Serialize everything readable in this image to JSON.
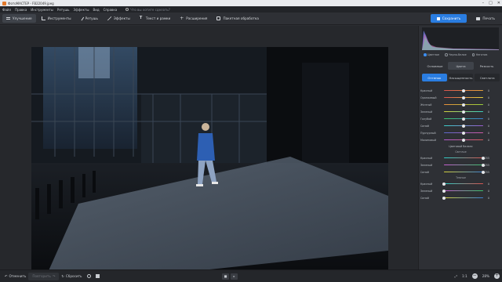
{
  "window": {
    "title": "ФотоМАСТЕР - FB22049.jpeg"
  },
  "menu": {
    "items": [
      "Файл",
      "Правка",
      "Инструменты",
      "Ретушь",
      "Эффекты",
      "Вид",
      "Справка"
    ],
    "search_placeholder": "Что вы хотите сделать?"
  },
  "toolbar": {
    "tools": [
      {
        "label": "Улучшение",
        "icon": "sliders-icon"
      },
      {
        "label": "Инструменты",
        "icon": "crop-icon"
      },
      {
        "label": "Ретушь",
        "icon": "brush-icon"
      },
      {
        "label": "Эффекты",
        "icon": "magic-wand-icon"
      },
      {
        "label": "Текст и рамки",
        "icon": "text-icon"
      },
      {
        "label": "Расширения",
        "icon": "plus-icon"
      },
      {
        "label": "Пакетная обработка",
        "icon": "batch-icon"
      }
    ],
    "save_label": "Сохранить",
    "print_label": "Печать"
  },
  "panel": {
    "radios": [
      {
        "label": "Цветное",
        "checked": true
      },
      {
        "label": "Черно-белое",
        "checked": false
      },
      {
        "label": "Негатив",
        "checked": false
      }
    ],
    "main_tabs": [
      "Основные",
      "Цвета",
      "Резкость"
    ],
    "main_tab_active": "Цвета",
    "sub_tabs": [
      "Оттенок",
      "Насыщенность",
      "Светлота"
    ],
    "sub_tab_active": "Оттенок",
    "hue": [
      {
        "label": "Красный",
        "value": "0",
        "colors": [
          "#d9534f",
          "#e8a33a"
        ]
      },
      {
        "label": "Оранжевый",
        "value": "0",
        "colors": [
          "#d9534f",
          "#e8d23a"
        ]
      },
      {
        "label": "Желтый",
        "value": "0",
        "colors": [
          "#e88f3a",
          "#9ad13a"
        ]
      },
      {
        "label": "Зеленый",
        "value": "0",
        "colors": [
          "#d6d13a",
          "#3ad1c1"
        ]
      },
      {
        "label": "Голубой",
        "value": "0",
        "colors": [
          "#3ac46a",
          "#3a7fd1"
        ]
      },
      {
        "label": "Синий",
        "value": "0",
        "colors": [
          "#3ad1c9",
          "#9b5ad1"
        ]
      },
      {
        "label": "Пурпурный",
        "value": "0",
        "colors": [
          "#5a6ad1",
          "#d15aa7"
        ]
      },
      {
        "label": "Малиновый",
        "value": "0",
        "colors": [
          "#b45ad1",
          "#d15a5a"
        ]
      }
    ],
    "white_balance": {
      "title": "Цветовой баланс",
      "highlights_title": "Светлые",
      "highlights": [
        {
          "label": "Красный",
          "value": "255",
          "colors": [
            "#2ad1c9",
            "#d9534f"
          ]
        },
        {
          "label": "Зеленый",
          "value": "255",
          "colors": [
            "#c95ad1",
            "#3ac46a"
          ]
        },
        {
          "label": "Синий",
          "value": "255",
          "colors": [
            "#d6d13a",
            "#3a7fd1"
          ]
        }
      ],
      "shadows_title": "Темные",
      "shadows": [
        {
          "label": "Красный",
          "value": "0",
          "colors": [
            "#2ad1c9",
            "#d9534f"
          ]
        },
        {
          "label": "Зеленый",
          "value": "0",
          "colors": [
            "#c95ad1",
            "#3ac46a"
          ]
        },
        {
          "label": "Синий",
          "value": "0",
          "colors": [
            "#d6d13a",
            "#3a7fd1"
          ]
        }
      ]
    }
  },
  "bottom": {
    "undo_label": "Отменить",
    "redo_label": "Повторить",
    "reset_label": "Сбросить",
    "ratio_label": "1:1",
    "zoom_label": "28%"
  }
}
